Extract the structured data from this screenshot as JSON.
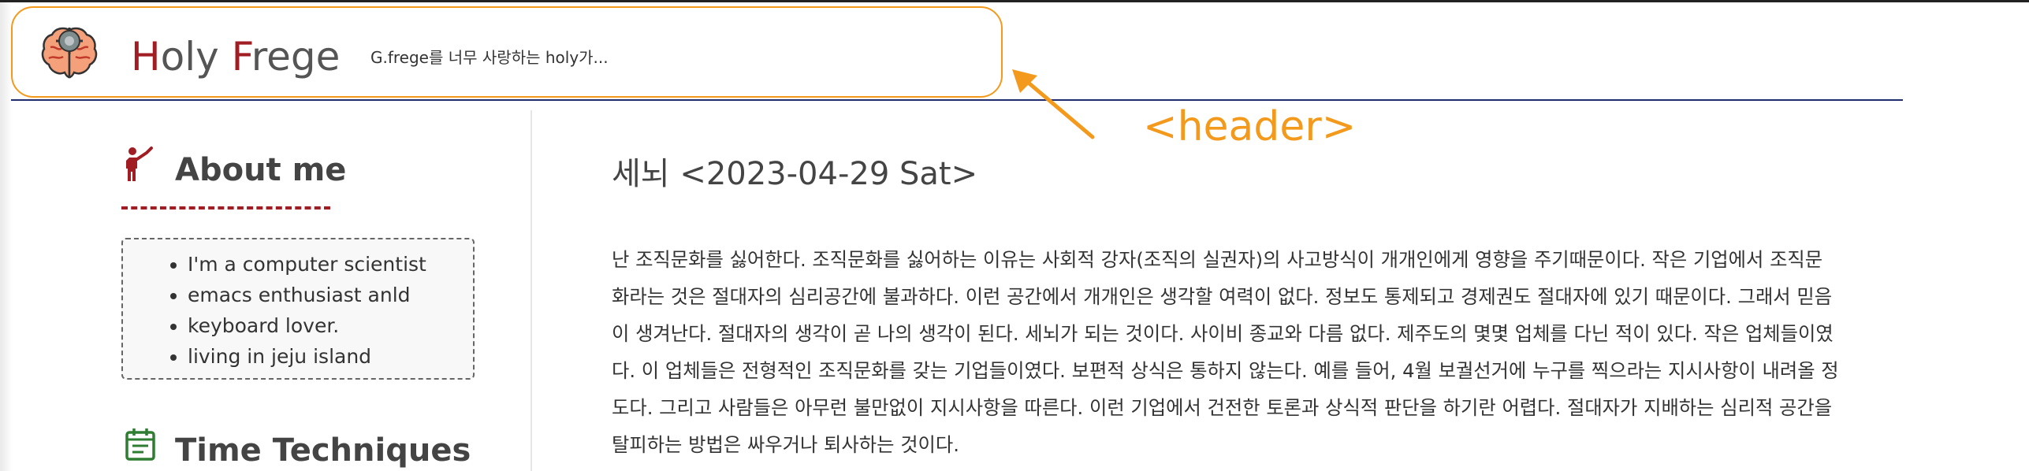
{
  "header": {
    "title_first_letter": "H",
    "title_rest_1": "oly ",
    "title_second_letter": "F",
    "title_rest_2": "rege",
    "tagline": "G.frege를 너무 사랑하는 holy가..."
  },
  "annotation": {
    "label": "<header>"
  },
  "sidebar": {
    "about": {
      "heading": "About me",
      "items": [
        "I'm a computer scientist",
        "emacs enthusiast anld",
        "keyboard lover.",
        "living in jeju island"
      ]
    },
    "time": {
      "heading": "Time Techniques"
    }
  },
  "post": {
    "title": "세뇌 <2023-04-29 Sat>",
    "lines": [
      "난 조직문화를 싫어한다. 조직문화를 싫어하는 이유는 사회적 강자(조직의 실권자)의 사고방식이 개개인에게 영향을 주기때문이다. 작은 기업에서 조직문",
      "화라는 것은 절대자의 심리공간에 불과하다. 이런 공간에서 개개인은 생각할 여력이 없다. 정보도 통제되고 경제권도 절대자에 있기 때문이다. 그래서 믿음",
      "이 생겨난다. 절대자의 생각이 곧 나의 생각이 된다. 세뇌가 되는 것이다. 사이비 종교와 다름 없다. 제주도의 몇몇 업체를 다닌 적이 있다. 작은 업체들이였",
      "다. 이 업체들은 전형적인 조직문화를 갖는 기업들이였다. 보편적 상식은 통하지 않는다. 예를 들어, 4월 보궐선거에 누구를 찍으라는 지시사항이 내려올 정",
      "도다. 그리고 사람들은 아무런 불만없이 지시사항을 따른다. 이런 기업에서 건전한 토론과 상식적 판단을 하기란 어렵다. 절대자가 지배하는 심리적 공간을",
      "탈피하는 방법은 싸우거나 퇴사하는 것이다."
    ]
  },
  "colors": {
    "accent_red": "#a01d24",
    "annotation_orange": "#f39a1d",
    "header_line_navy": "#1f2c6e",
    "calendar_green": "#2e7d32"
  },
  "icons": {
    "logo": "brain-gear-icon",
    "about": "person-waving-icon",
    "time": "calendar-icon",
    "annotation": "arrow-icon"
  }
}
